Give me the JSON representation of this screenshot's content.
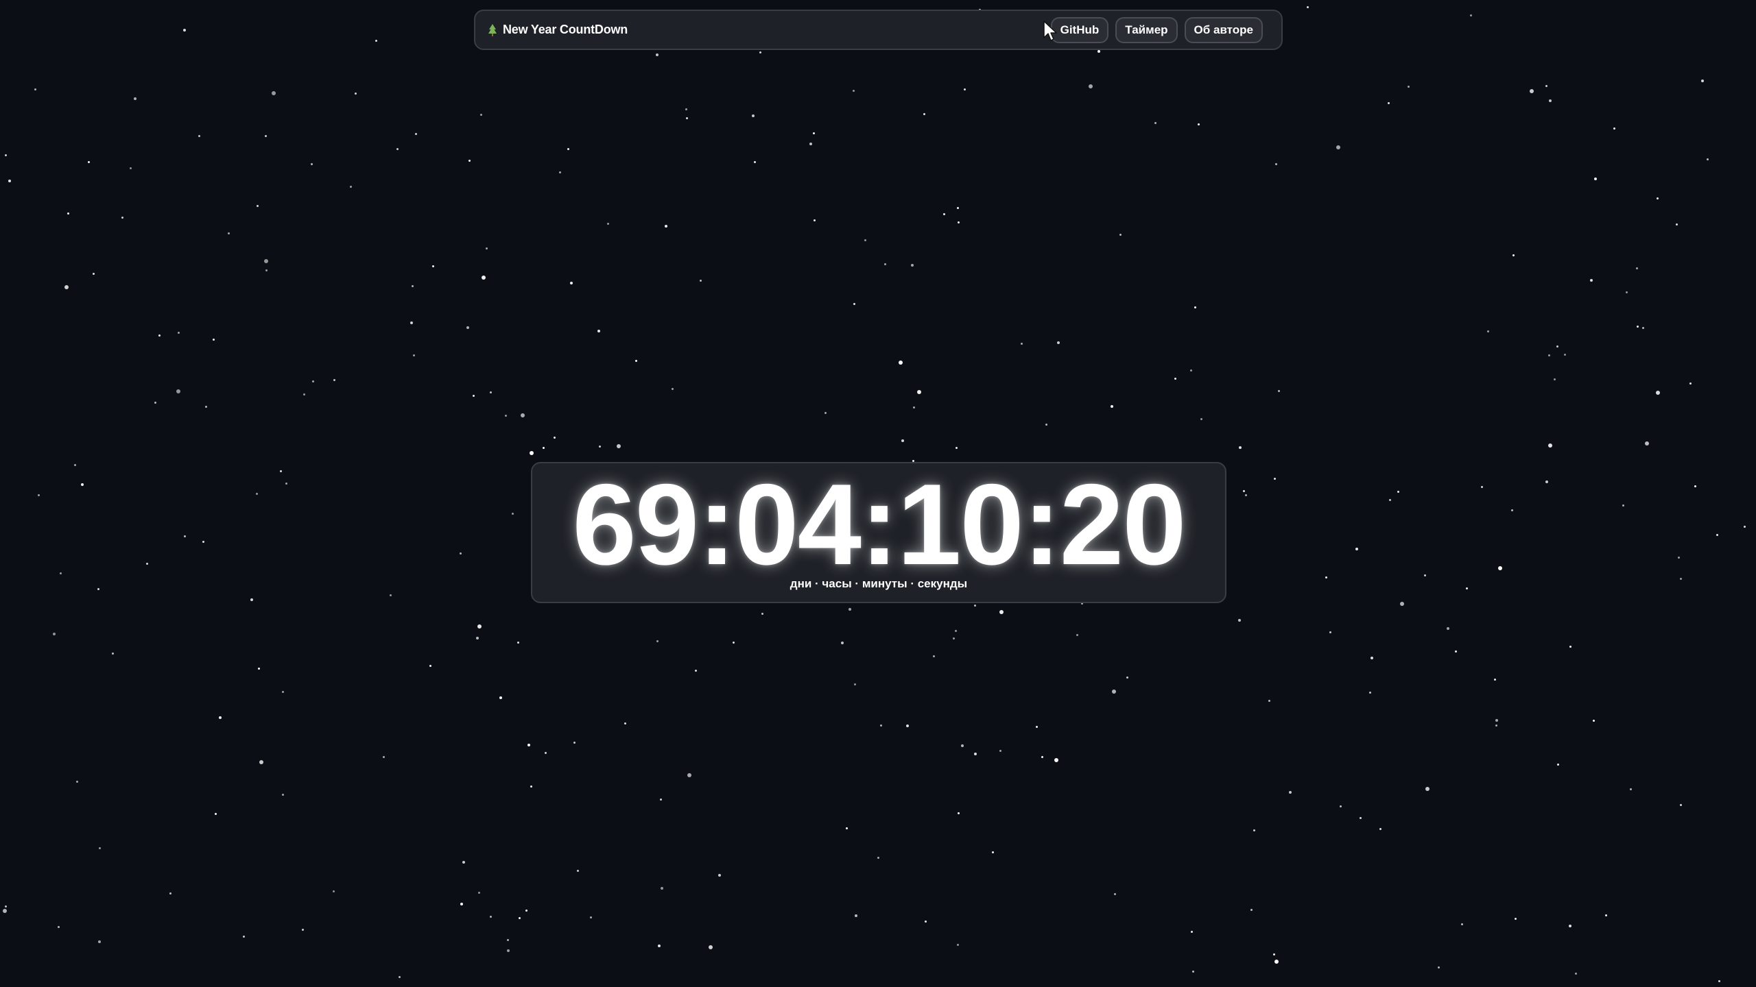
{
  "navbar": {
    "icon": "tree-icon",
    "title": "New Year CountDown",
    "buttons": [
      {
        "label": "GitHub"
      },
      {
        "label": "Таймер"
      },
      {
        "label": "Об авторе"
      }
    ]
  },
  "countdown": {
    "value": "69:04:10:20",
    "units_label": "дни · часы · минуты · секунды"
  },
  "colors": {
    "background": "#0b0e14",
    "panel": "#1e2127",
    "text": "#ffffff",
    "tree_accent": "#7fb35a"
  },
  "cursor": {
    "icon": "mouse-pointer-icon"
  }
}
